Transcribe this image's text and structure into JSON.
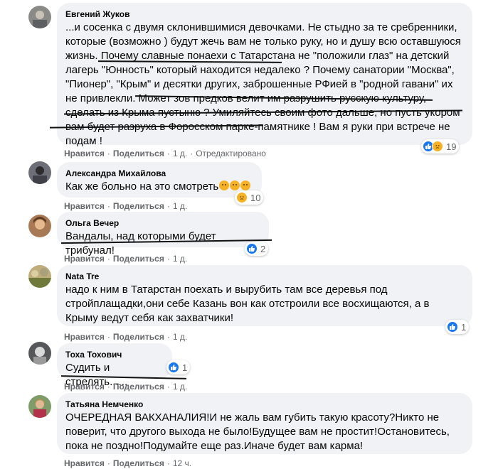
{
  "actions": {
    "like": "Нравится",
    "reply": "Поделиться",
    "sep": "·"
  },
  "comments": [
    {
      "author": "Евгений Жуков",
      "text": "...и сосенка с двумя склонившимися девочками. Не стыдно за те сребренники, которые (возможно ) будут жечь вам не только руку, но и душу всю оставшуюся жизнь. Почему славные понаехи с Татарстана не \"положили глаз\" на детский лагерь \"Юнность\" который находится недалеко ? Почему санатории \"Москва\", \"Пионер\", \"Крым\" и десятки других, заброшенные РФией в \"родной гавани\" их не привлекли. Может зов предков велит им разрушить русскую культуру, сделать из Крыма пустыню ? Умиляйтесь своим фото дальше, но пусть укором вам будет разруха в Форосском парке-памятнике ! Вам я руки при встрече не подам !",
      "time": "1 д.",
      "edited": "Отредактировано",
      "reactions": [
        "like",
        "sad"
      ],
      "count": "19"
    },
    {
      "author": "Александра Михайлова",
      "text": "Как же больно на это смотреть",
      "emojis": 3,
      "time": "1 д.",
      "reactions": [
        "sad"
      ],
      "count": "10"
    },
    {
      "author": "Ольга Вечер",
      "text": "Вандалы, над которыми будет трибунал!",
      "time": "1 д.",
      "reactions": [
        "like"
      ],
      "count": "2"
    },
    {
      "author": "Nata Tre",
      "text": "надо к ним в Татарстан поехать и вырубить там все деревья под стройплащадки,они себе Казань вон как отстроили все восхищаются, а в Крыму ведут себя как захватчики!",
      "time": "1 д.",
      "reactions": [
        "like"
      ],
      "count": "1"
    },
    {
      "author": "Тоха Тохович",
      "text": "Судить и стрелять......",
      "time": "1 д.",
      "reactions": [
        "like"
      ],
      "count": "1"
    },
    {
      "author": "Татьяна Немченко",
      "text": "ОЧЕРЕДНАЯ ВАКХАНАЛИЯ!И не жаль вам губить такую красоту?Никто не поверит, что другого выхода не было!Будущее вам не простит!Остановитесь, пока не поздно!Подумайте еще раз.Иначе будет вам карма!",
      "time": "12 ч."
    }
  ]
}
